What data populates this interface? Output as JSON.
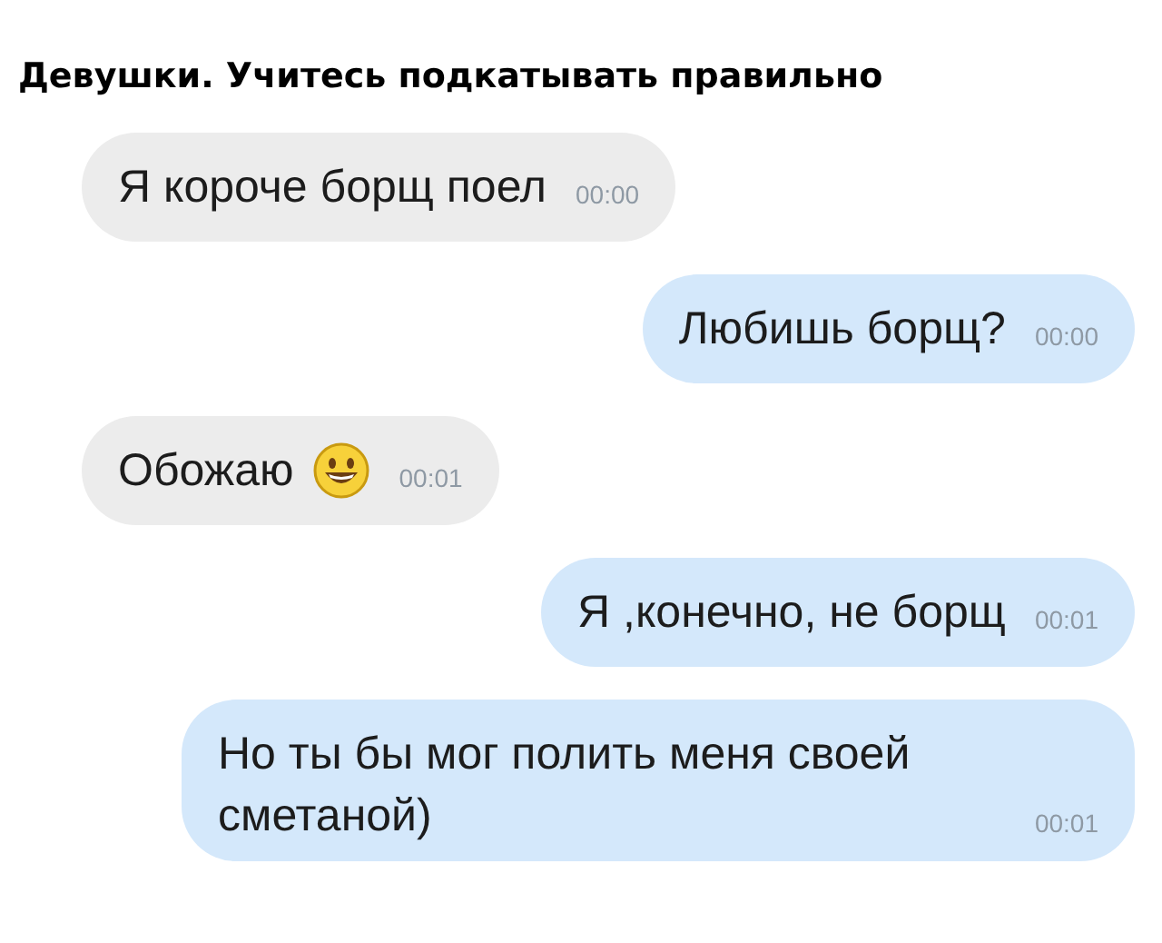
{
  "title": "Девушки. Учитесь подкатывать правильно",
  "messages": [
    {
      "outgoing": false,
      "text": "Я короче борщ поел",
      "time": "00:00",
      "emoji": false
    },
    {
      "outgoing": true,
      "text": "Любишь борщ?",
      "time": "00:00",
      "emoji": false
    },
    {
      "outgoing": false,
      "text": "Обожаю",
      "time": "00:01",
      "emoji": true
    },
    {
      "outgoing": true,
      "text": "Я ,конечно, не борщ",
      "time": "00:01",
      "emoji": false
    },
    {
      "outgoing": true,
      "text": "Но ты бы мог полить меня своей сметаной)",
      "time": "00:01",
      "emoji": false
    }
  ]
}
